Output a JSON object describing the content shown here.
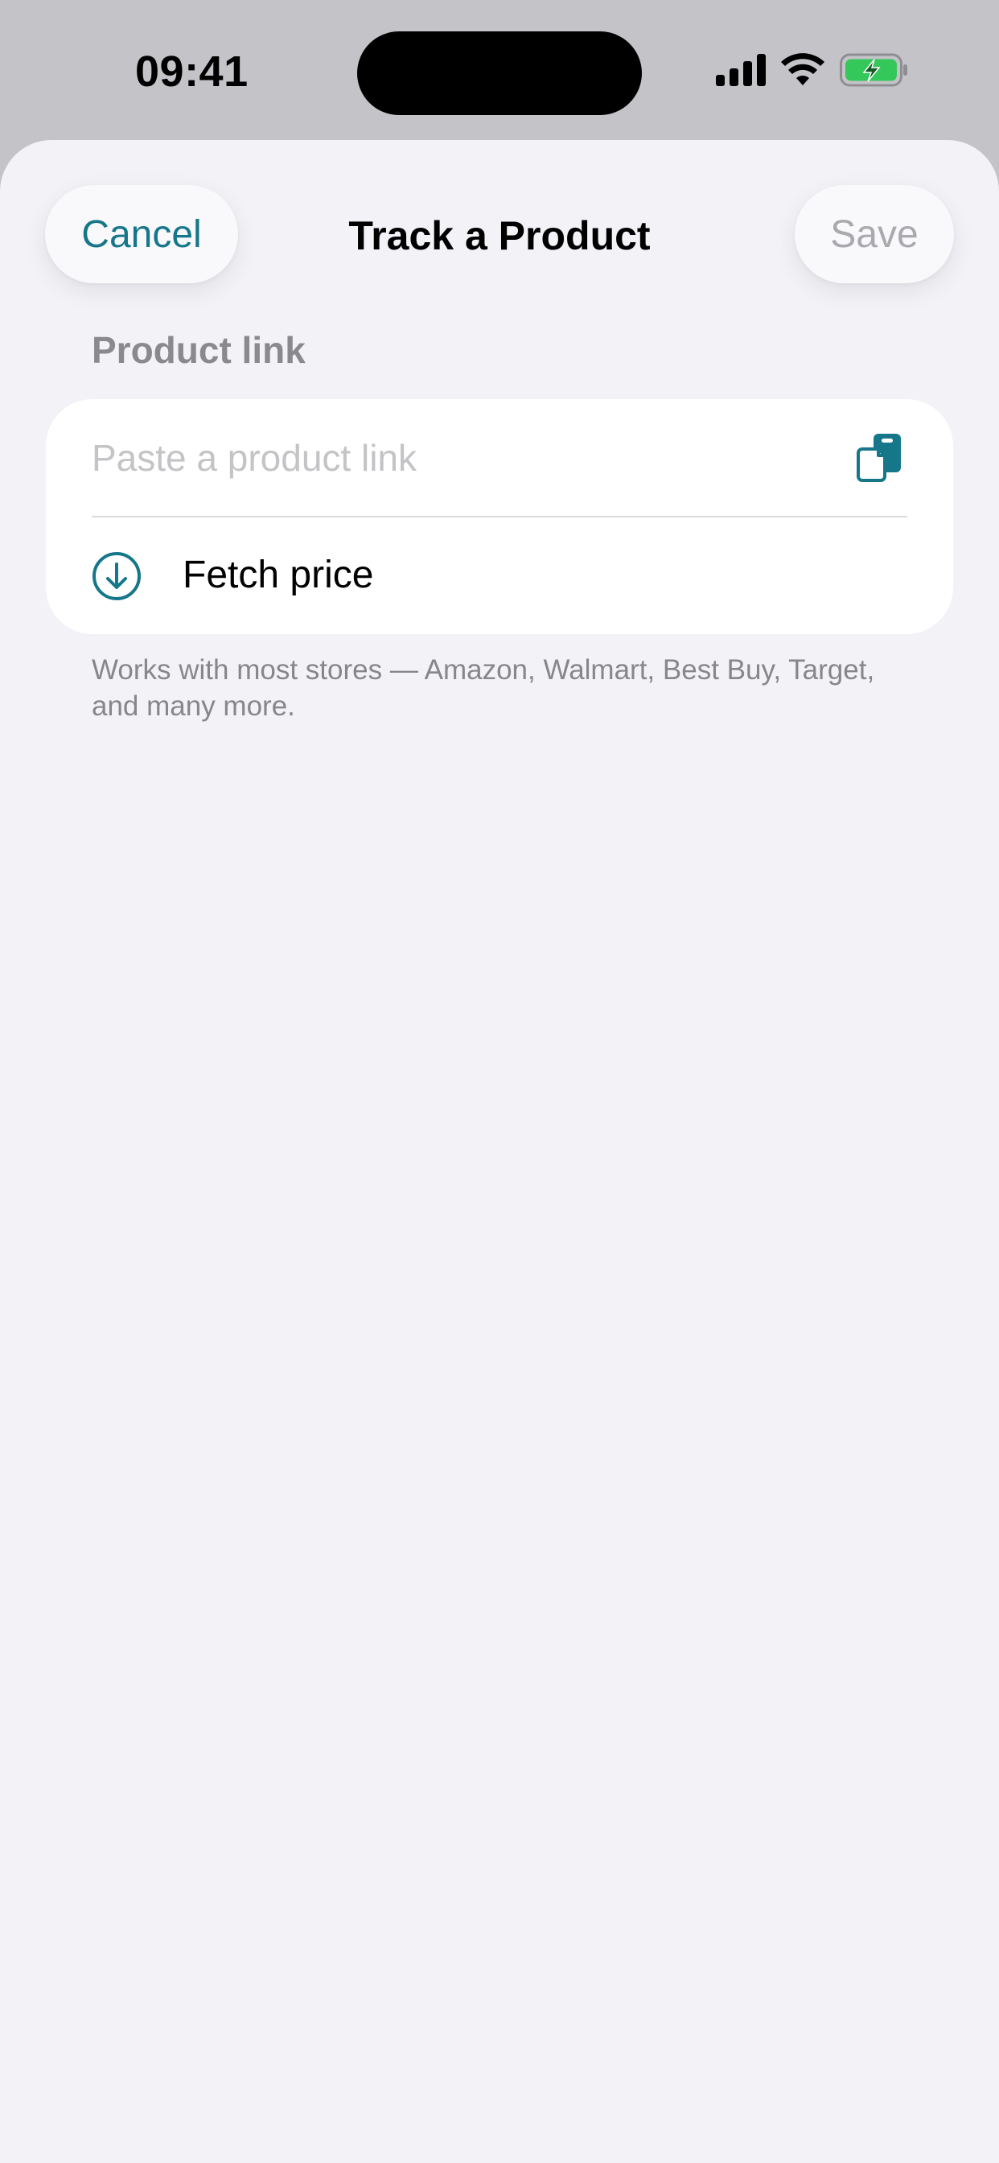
{
  "status_bar": {
    "time": "09:41",
    "icons": [
      "cellular-signal-icon",
      "wifi-icon",
      "battery-charging-icon"
    ]
  },
  "nav": {
    "cancel_label": "Cancel",
    "title": "Track a Product",
    "save_label": "Save"
  },
  "form": {
    "section_label": "Product link",
    "link_input": {
      "value": "",
      "placeholder": "Paste a product link"
    },
    "paste_icon": "paste-from-clipboard-icon",
    "fetch_label": "Fetch price",
    "fetch_icon": "arrow-down-circle-icon",
    "footnote": "Works with most stores — Amazon, Walmart, Best Buy, Target, and many more."
  },
  "colors": {
    "accent": "#16778a",
    "disabled": "#a9a9ae",
    "sheet_background": "#f2f2f7",
    "battery_fill": "#34c759"
  }
}
